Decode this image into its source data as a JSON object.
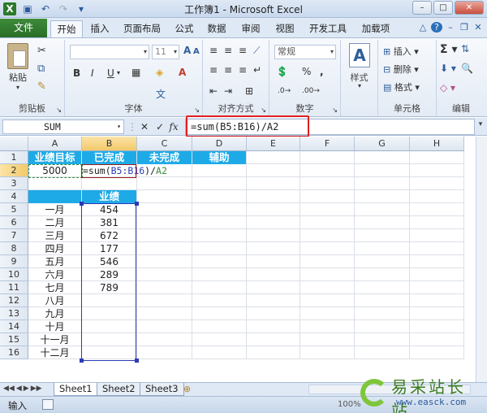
{
  "window": {
    "title": "工作簿1 - Microsoft Excel"
  },
  "ribbon_tabs": [
    "文件",
    "开始",
    "插入",
    "页面布局",
    "公式",
    "数据",
    "审阅",
    "视图",
    "开发工具",
    "加载项"
  ],
  "ribbon": {
    "clipboard": {
      "paste": "粘贴",
      "label": "剪贴板"
    },
    "font": {
      "size": "11",
      "label": "字体",
      "bold": "B",
      "italic": "I",
      "underline": "U"
    },
    "alignment": {
      "label": "对齐方式"
    },
    "number": {
      "format": "常规",
      "label": "数字"
    },
    "styles": {
      "label": "样式"
    },
    "cells": {
      "insert": "插入",
      "delete": "删除",
      "format": "格式",
      "label": "单元格"
    },
    "editing": {
      "label": "编辑"
    }
  },
  "formula_bar": {
    "name_box": "SUM",
    "formula": "=sum(B5:B16)/A2"
  },
  "columns": [
    "A",
    "B",
    "C",
    "D",
    "E",
    "F",
    "G",
    "H"
  ],
  "rows": [
    "1",
    "2",
    "3",
    "4",
    "5",
    "6",
    "7",
    "8",
    "9",
    "10",
    "11",
    "12",
    "13",
    "14",
    "15",
    "16"
  ],
  "cells": {
    "A1": "业绩目标",
    "B1": "已完成",
    "C1": "未完成",
    "D1": "辅助",
    "A2": "5000",
    "B2_prefix": "=sum(",
    "B2_range": "B5:B16",
    "B2_suffix": ")/",
    "B2_ref": "A2",
    "B4": "业绩",
    "months": [
      "一月",
      "二月",
      "三月",
      "四月",
      "五月",
      "六月",
      "七月",
      "八月",
      "九月",
      "十月",
      "十一月",
      "十二月"
    ],
    "values": [
      "454",
      "381",
      "672",
      "177",
      "546",
      "289",
      "789",
      "",
      "",
      "",
      "",
      ""
    ]
  },
  "sheets": [
    "Sheet1",
    "Sheet2",
    "Sheet3"
  ],
  "status": {
    "mode": "输入",
    "zoom": "100%"
  },
  "watermark": {
    "name": "易采站长站",
    "url": "www.easck.com"
  },
  "colors": {
    "header_fill": "#1eaae7",
    "formula_highlight": "#e02020",
    "selection": "#2c3ab5",
    "range_ref": "#2c3ab5",
    "cell_ref": "#3a8a3a"
  }
}
